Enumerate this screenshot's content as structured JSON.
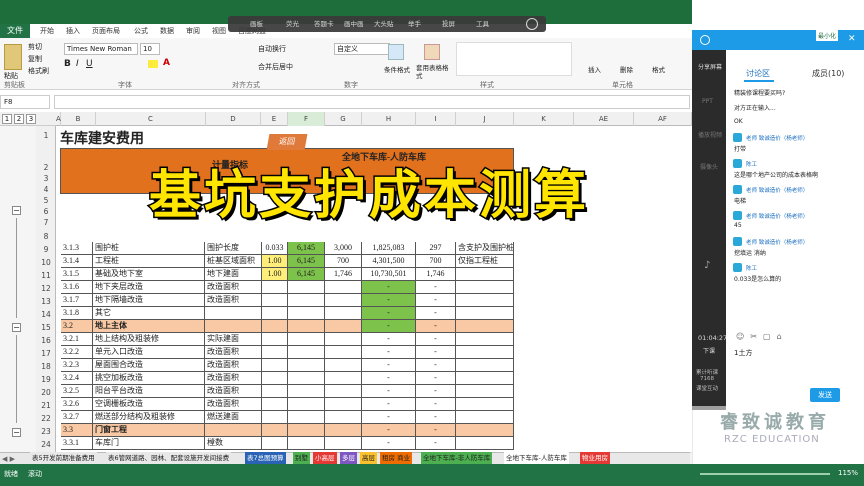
{
  "ribbon": {
    "file_tab": "文件",
    "tabs": [
      "开始",
      "插入",
      "页面布局",
      "公式",
      "数据",
      "审阅",
      "视图",
      "百度网盘"
    ],
    "font_name": "Times New Roman",
    "font_size": "10",
    "clipboard": {
      "cut": "剪切",
      "copy": "复制",
      "format_painter": "格式刷",
      "paste": "粘贴",
      "label": "剪贴板"
    },
    "font_label": "字体",
    "align_label": "对齐方式",
    "wrap": "自动换行",
    "merge": "合并后居中",
    "number_format": "自定义",
    "number_label": "数字",
    "cond_format": "条件格式",
    "table_format": "套用表格格式",
    "style_label": "样式",
    "insert": "插入",
    "delete": "删除",
    "format": "格式",
    "cells_label": "单元格"
  },
  "overlay_bar": {
    "buttons": [
      "画板",
      "荧光",
      "答题卡",
      "画中画",
      "大头贴",
      "举手",
      "投屏",
      "工具"
    ]
  },
  "formula_bar": {
    "name_box": "F8"
  },
  "outline_levels": [
    "1",
    "2",
    "3"
  ],
  "columns": [
    "A",
    "B",
    "C",
    "D",
    "E",
    "F",
    "G",
    "H",
    "I",
    "J",
    "K",
    "AE",
    "AF"
  ],
  "sheet": {
    "title": "车库建安费用",
    "back_button": "返回",
    "header_fragments": [
      "计量指标",
      "全地下车库-人防车库"
    ],
    "rows": [
      {
        "n": "1"
      },
      {
        "n": "2"
      },
      {
        "n": "3"
      },
      {
        "n": "4"
      },
      {
        "n": "5"
      },
      {
        "n": "6"
      },
      {
        "n": "7"
      },
      {
        "n": "8"
      },
      {
        "n": "9",
        "code": "3.1.3",
        "name": "围护桩",
        "unit": "围护长度",
        "e": "0.033",
        "f": "6,145",
        "g": "3,000",
        "h": "1,825,083",
        "i": "297",
        "j": "含支护及围护桩"
      },
      {
        "n": "10",
        "code": "3.1.4",
        "name": "工程桩",
        "unit": "桩基区域面积",
        "e": "1.00",
        "f": "6,145",
        "g": "700",
        "h": "4,301,500",
        "i": "700",
        "j": "仅指工程桩"
      },
      {
        "n": "11",
        "code": "3.1.5",
        "name": "基础及地下室",
        "unit": "地下建面",
        "e": "1.00",
        "f": "6,145",
        "g": "1,746",
        "h": "10,730,501",
        "i": "1,746",
        "j": ""
      },
      {
        "n": "12",
        "code": "3.1.6",
        "name": "地下夹层改造",
        "unit": "改造面积",
        "e": "",
        "f": "",
        "g": "",
        "h": "-",
        "i": "-",
        "j": ""
      },
      {
        "n": "13",
        "code": "3.1.7",
        "name": "地下隔墙改造",
        "unit": "改造面积",
        "e": "",
        "f": "",
        "g": "",
        "h": "-",
        "i": "-",
        "j": ""
      },
      {
        "n": "14",
        "code": "3.1.8",
        "name": "其它",
        "unit": "",
        "e": "",
        "f": "",
        "g": "",
        "h": "-",
        "i": "-",
        "j": ""
      },
      {
        "n": "15",
        "code": "3.2",
        "name": "地上主体",
        "unit": "",
        "e": "",
        "f": "",
        "g": "",
        "h": "-",
        "i": "-",
        "j": "",
        "sec": true
      },
      {
        "n": "16",
        "code": "3.2.1",
        "name": "地上结构及粗装修",
        "unit": "实际建面",
        "e": "",
        "f": "",
        "g": "",
        "h": "-",
        "i": "-",
        "j": ""
      },
      {
        "n": "17",
        "code": "3.2.2",
        "name": "单元入口改造",
        "unit": "改造面积",
        "e": "",
        "f": "",
        "g": "",
        "h": "-",
        "i": "-",
        "j": ""
      },
      {
        "n": "18",
        "code": "3.2.3",
        "name": "屋面围合改造",
        "unit": "改造面积",
        "e": "",
        "f": "",
        "g": "",
        "h": "-",
        "i": "-",
        "j": ""
      },
      {
        "n": "19",
        "code": "3.2.4",
        "name": "挑空加板改造",
        "unit": "改造面积",
        "e": "",
        "f": "",
        "g": "",
        "h": "-",
        "i": "-",
        "j": ""
      },
      {
        "n": "20",
        "code": "3.2.5",
        "name": "阳台平台改造",
        "unit": "改造面积",
        "e": "",
        "f": "",
        "g": "",
        "h": "-",
        "i": "-",
        "j": ""
      },
      {
        "n": "21",
        "code": "3.2.6",
        "name": "空调栅板改造",
        "unit": "改造面积",
        "e": "",
        "f": "",
        "g": "",
        "h": "-",
        "i": "-",
        "j": ""
      },
      {
        "n": "22",
        "code": "3.2.7",
        "name": "燃送部分结构及粗装修",
        "unit": "燃送建面",
        "e": "",
        "f": "",
        "g": "",
        "h": "-",
        "i": "-",
        "j": ""
      },
      {
        "n": "23",
        "code": "3.3",
        "name": "门窗工程",
        "unit": "",
        "e": "",
        "f": "",
        "g": "",
        "h": "-",
        "i": "-",
        "j": "",
        "sec": true
      },
      {
        "n": "24",
        "code": "3.3.1",
        "name": "车库门",
        "unit": "樘数",
        "e": "",
        "f": "",
        "g": "",
        "h": "-",
        "i": "-",
        "j": ""
      }
    ]
  },
  "banner": "基坑支护成本测算",
  "sheet_tabs": [
    {
      "label": "表5开发前期准备费用",
      "color": "#e8e8e8"
    },
    {
      "label": "表6管网道路、园林、配套设施开发间接费",
      "color": "#e8e8e8"
    },
    {
      "label": "表7总图预算",
      "color": "#2a63b5"
    },
    {
      "label": "别墅",
      "color": "#4caf50"
    },
    {
      "label": "小高层",
      "color": "#e53935"
    },
    {
      "label": "多层",
      "color": "#7e57c2"
    },
    {
      "label": "高层",
      "color": "#fbc02d"
    },
    {
      "label": "租房 商业",
      "color": "#ef6c00"
    },
    {
      "label": "全地下车库-非人防车库",
      "color": "#4caf50"
    },
    {
      "label": "全地下车库-人防车库",
      "color": "#ffffff"
    },
    {
      "label": "物业用房",
      "color": "#e53935"
    }
  ],
  "status": {
    "ready": "就绪",
    "scroll": "滚动",
    "zoom": "115%"
  },
  "panel": {
    "minimize": "最小化",
    "tab_discussion": "讨论区",
    "tab_members": "成员(10)",
    "sidebar": [
      "分享屏幕",
      "PPT",
      "播放视频",
      "摄像头"
    ],
    "timer": "01:04:27",
    "timer_label": "下课",
    "stats": [
      "累计听课",
      "7168",
      "课堂互动"
    ],
    "messages": [
      {
        "user": "",
        "text": "精装修课程要买吗?"
      },
      {
        "user": "",
        "text": "对方正在输入..."
      },
      {
        "user": "",
        "text": "OK"
      },
      {
        "user": "老师 致诚造价（杨老师）",
        "text": "打带"
      },
      {
        "user": "陈工",
        "text": "这是哪个地产公司的成本表格啊"
      },
      {
        "user": "老师 致诚造价（杨老师）",
        "text": "电梯"
      },
      {
        "user": "老师 致诚造价（杨老师）",
        "text": "45"
      },
      {
        "user": "老师 致诚造价（杨老师）",
        "text": "挖填运  消纳"
      },
      {
        "user": "陈工",
        "text": "0.033是怎么算的"
      }
    ],
    "input_value": "1土方",
    "send": "发送"
  },
  "watermark": {
    "name": "睿致诚教育",
    "en": "RZC EDUCATION"
  }
}
